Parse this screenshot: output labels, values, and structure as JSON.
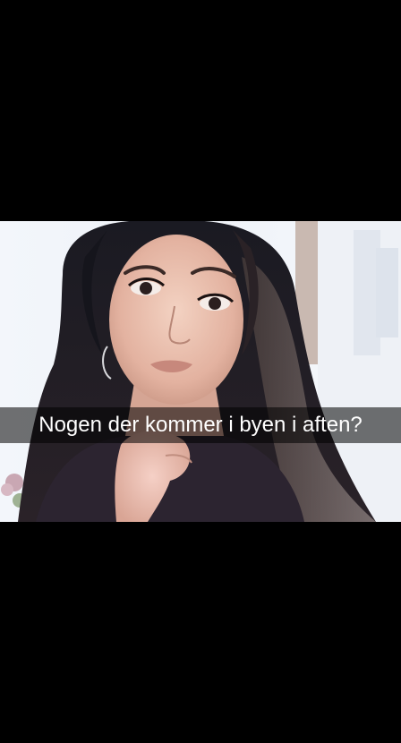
{
  "snap": {
    "caption": "Nogen der kommer i byen i aften?",
    "photo_subject": "selfie-photo"
  },
  "colors": {
    "background": "#000000",
    "caption_text": "#ffffff",
    "caption_bar": "rgba(0,0,0,0.55)"
  }
}
